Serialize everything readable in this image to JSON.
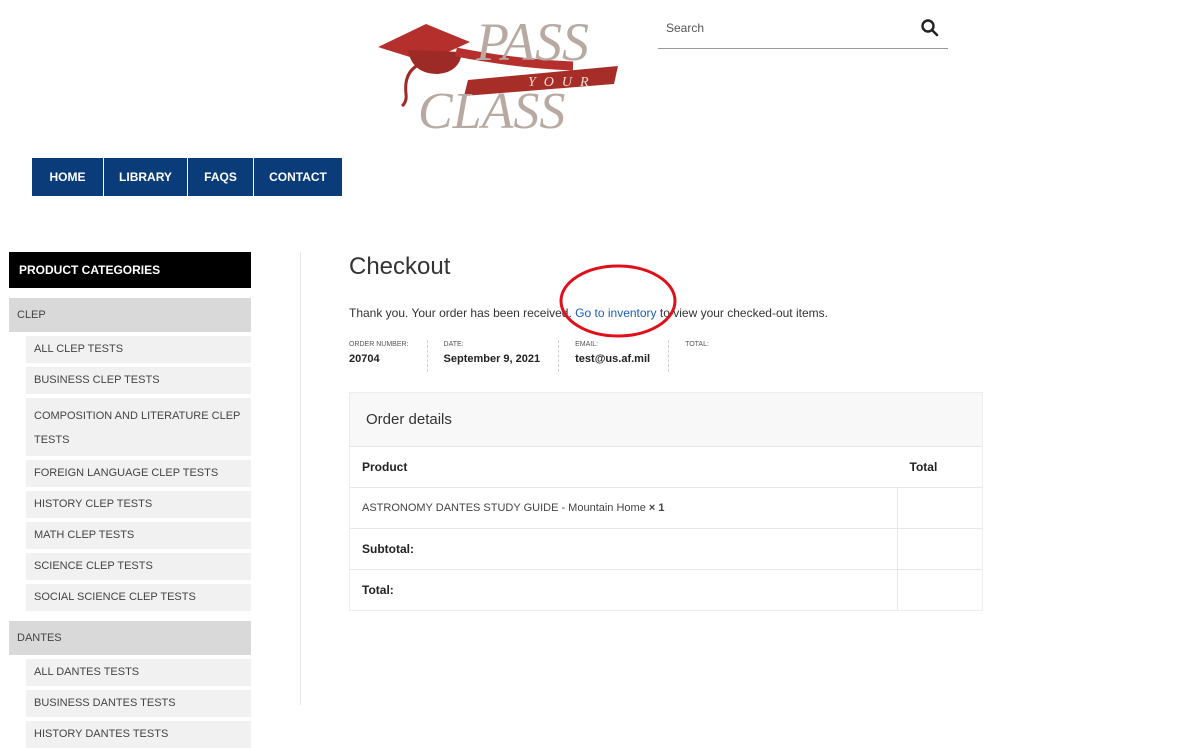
{
  "logo": {
    "line1": "PASS",
    "line2": "YOUR",
    "line3": "CLASS"
  },
  "search": {
    "placeholder": "Search",
    "icon": "search-icon"
  },
  "nav": {
    "home": "HOME",
    "library": "LIBRARY",
    "faqs": "FAQS",
    "contact": "CONTACT",
    "color": "#0b3c7a"
  },
  "sidebar": {
    "title": "PRODUCT CATEGORIES",
    "clep": {
      "label": "CLEP",
      "items": [
        "ALL CLEP TESTS",
        "BUSINESS CLEP TESTS",
        "COMPOSITION AND LITERATURE CLEP TESTS",
        "FOREIGN LANGUAGE CLEP TESTS",
        "HISTORY CLEP TESTS",
        "MATH CLEP TESTS",
        "SCIENCE CLEP TESTS",
        "SOCIAL SCIENCE CLEP TESTS"
      ]
    },
    "dantes": {
      "label": "DANTES",
      "items": [
        "ALL DANTES TESTS",
        "BUSINESS DANTES TESTS",
        "HISTORY DANTES TESTS"
      ]
    }
  },
  "main": {
    "title": "Checkout",
    "notice": {
      "pre": "Thank you. Your order has been received.",
      "link": "Go to inventory",
      "post": "to view your checked-out items."
    },
    "overview": {
      "order_label": "ORDER NUMBER:",
      "order_value": "20704",
      "date_label": "DATE:",
      "date_value": "September 9, 2021",
      "email_label": "EMAIL:",
      "email_value": "test@us.af.mil",
      "total_label": "TOTAL:",
      "total_value": ""
    },
    "details": {
      "heading": "Order details",
      "col_product": "Product",
      "col_total": "Total",
      "item": "ASTRONOMY DANTES STUDY GUIDE - Mountain Home",
      "item_qty": "× 1",
      "subtotal_label": "Subtotal:",
      "total_label": "Total:"
    }
  },
  "annotation": {
    "color": "#e0101a"
  }
}
